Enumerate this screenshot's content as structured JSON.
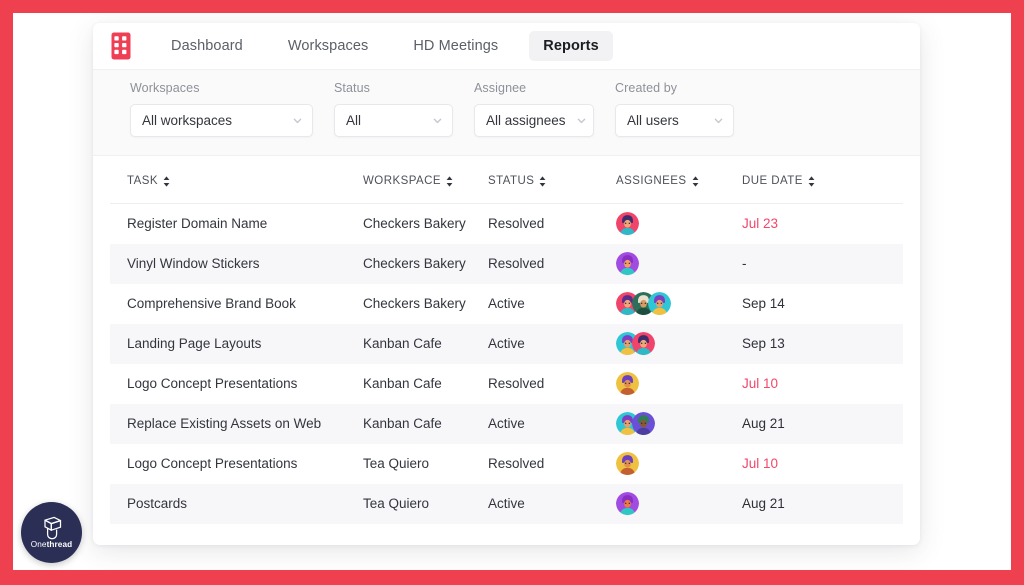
{
  "frame": {
    "accent_color": "#ef4050"
  },
  "nav": {
    "logo_icon": "building-grid-icon",
    "tabs": [
      {
        "label": "Dashboard",
        "active": false
      },
      {
        "label": "Workspaces",
        "active": false
      },
      {
        "label": "HD Meetings",
        "active": false
      },
      {
        "label": "Reports",
        "active": true
      }
    ]
  },
  "filters": [
    {
      "label": "Workspaces",
      "value": "All workspaces",
      "width_class": "w-ws",
      "name": "workspaces"
    },
    {
      "label": "Status",
      "value": "All",
      "width_class": "w-st",
      "name": "status"
    },
    {
      "label": "Assignee",
      "value": "All assignees",
      "width_class": "w-as",
      "name": "assignee"
    },
    {
      "label": "Created by",
      "value": "All users",
      "width_class": "w-cb",
      "name": "created-by"
    }
  ],
  "table": {
    "columns": [
      {
        "label": "TASK",
        "key": "task",
        "class": "col-task",
        "sortable": true
      },
      {
        "label": "WORKSPACE",
        "key": "workspace",
        "class": "col-ws",
        "sortable": true
      },
      {
        "label": "STATUS",
        "key": "status",
        "class": "col-st",
        "sortable": true
      },
      {
        "label": "ASSIGNEES",
        "key": "assignees",
        "class": "col-as",
        "sortable": true
      },
      {
        "label": "DUE DATE",
        "key": "due",
        "class": "col-dd",
        "sortable": true
      }
    ],
    "rows": [
      {
        "task": "Register Domain Name",
        "workspace": "Checkers Bakery",
        "status": "Resolved",
        "due": "Jul 23",
        "overdue": true,
        "assignees": [
          {
            "bg": "#f0446b",
            "hair": "#3f2d6b",
            "skin": "#f0a878",
            "shirt": "#2fb8c6"
          }
        ]
      },
      {
        "task": "Vinyl Window Stickers",
        "workspace": "Checkers Bakery",
        "status": "Resolved",
        "due": "-",
        "overdue": false,
        "assignees": [
          {
            "bg": "#a14be0",
            "hair": "#8a2fc4",
            "skin": "#f2a060",
            "shirt": "#2fc6c6"
          }
        ]
      },
      {
        "task": "Comprehensive Brand Book",
        "workspace": "Checkers Bakery",
        "status": "Active",
        "due": "Sep 14",
        "overdue": false,
        "assignees": [
          {
            "bg": "#f0446b",
            "hair": "#5b2d8a",
            "skin": "#f0a878",
            "shirt": "#2fb8c6"
          },
          {
            "bg": "#2e6f5a",
            "hair": "#e8e0cf",
            "skin": "#d89b63",
            "shirt": "#1d4f3f"
          },
          {
            "bg": "#2fc6d6",
            "hair": "#7b3fc4",
            "skin": "#e8a06a",
            "shirt": "#f0c040"
          }
        ]
      },
      {
        "task": "Landing Page Layouts",
        "workspace": "Kanban Cafe",
        "status": "Active",
        "due": "Sep 13",
        "overdue": false,
        "assignees": [
          {
            "bg": "#2fc6d6",
            "hair": "#7b3fc4",
            "skin": "#e8a06a",
            "shirt": "#f0c040"
          },
          {
            "bg": "#f0446b",
            "hair": "#3f2d6b",
            "skin": "#f0a878",
            "shirt": "#2fb8c6"
          }
        ]
      },
      {
        "task": "Logo Concept Presentations",
        "workspace": "Kanban Cafe",
        "status": "Resolved",
        "due": "Jul 10",
        "overdue": true,
        "assignees": [
          {
            "bg": "#f0c040",
            "hair": "#6b3fc4",
            "skin": "#e09050",
            "shirt": "#c4602f"
          }
        ]
      },
      {
        "task": "Replace Existing Assets on Web",
        "workspace": "Kanban Cafe",
        "status": "Active",
        "due": "Aug 21",
        "overdue": false,
        "assignees": [
          {
            "bg": "#2fc6d6",
            "hair": "#7b3fc4",
            "skin": "#e8a06a",
            "shirt": "#f0c040"
          },
          {
            "bg": "#6b4fd6",
            "hair": "#2f7f5a",
            "skin": "#8a5a33",
            "shirt": "#4a3fa0"
          }
        ]
      },
      {
        "task": "Logo Concept Presentations",
        "workspace": "Tea Quiero",
        "status": "Resolved",
        "due": "Jul 10",
        "overdue": true,
        "assignees": [
          {
            "bg": "#f0c040",
            "hair": "#6b3fc4",
            "skin": "#e09050",
            "shirt": "#c4602f"
          }
        ]
      },
      {
        "task": "Postcards",
        "workspace": "Tea Quiero",
        "status": "Active",
        "due": "Aug 21",
        "overdue": false,
        "assignees": [
          {
            "bg": "#a14be0",
            "hair": "#8a2fc4",
            "skin": "#f07a40",
            "shirt": "#2fc6c6"
          }
        ]
      }
    ]
  },
  "badge": {
    "icon": "onethread-cube-icon",
    "text_light": "One",
    "text_bold": "thread"
  }
}
